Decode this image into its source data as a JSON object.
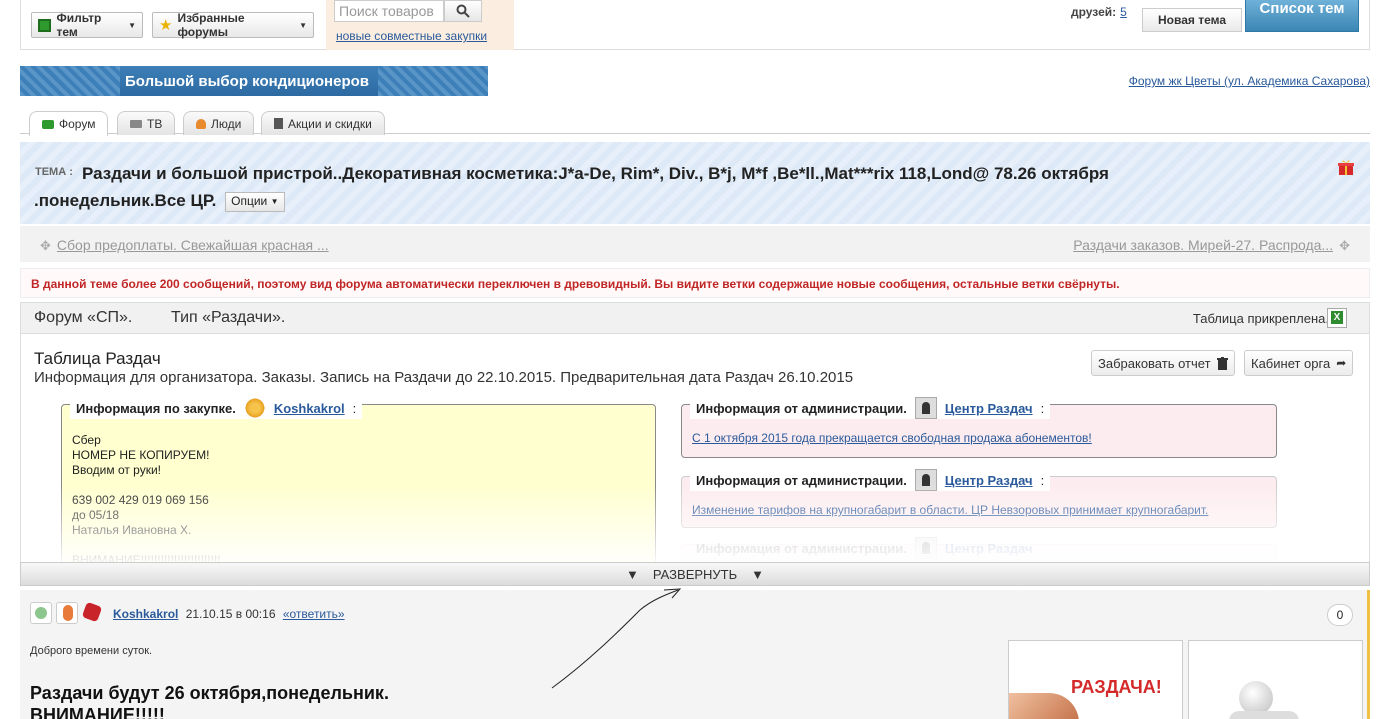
{
  "header": {
    "filter_label": "Фильтр тем",
    "favorites_label": "Избранные форумы",
    "search_placeholder": "Поиск товаров",
    "joint_purchases_link": "новые совместные закупки",
    "friends_label": "друзей:",
    "friends_count": "5",
    "new_topic_label": "Новая тема",
    "topic_list_label": "Список тем"
  },
  "banner": {
    "text": "Большой выбор кондиционеров",
    "forum_link": "Форум жк Цветы (ул. Академика Сахарова)"
  },
  "tabs": [
    {
      "label": "Форум",
      "icon": "chat-icon"
    },
    {
      "label": "ТВ",
      "icon": "tv-icon"
    },
    {
      "label": "Люди",
      "icon": "people-icon"
    },
    {
      "label": "Акции и скидки",
      "icon": "document-icon"
    }
  ],
  "topic": {
    "label": "ТЕМА :",
    "title": "Раздачи и большой пристрой..Декоративная косметика:J*a-De, Rim*, Div., B*j, M*f ,Be*ll.,Mat***rix 118,Lond@ 78.26 октября .понедельник.Все ЦР.",
    "options_label": "Опции"
  },
  "nav": {
    "prev": "Сбор предоплаты. Свежайшая красная ...",
    "next": "Раздачи заказов. Мирей-27. Распрода..."
  },
  "warning": "В данной теме более 200 сообщений, поэтому вид форума автоматически переключен в древовидный. Вы видите ветки содержащие новые сообщения, остальные ветки свёрнуты.",
  "forum_type": {
    "forum": "Форум «СП».",
    "type": "Тип «Раздачи».",
    "attached": "Таблица прикреплена."
  },
  "table_card": {
    "title": "Таблица Раздач",
    "subtitle": "Информация для организатора. Заказы. Запись на Раздачи до 22.10.2015. Предварительная дата Раздач 26.10.2015",
    "reject_btn": "Забраковать отчет",
    "cabinet_btn": "Кабинет орга",
    "purchase_info": {
      "legend": "Информация по закупке.",
      "user": "Koshkakrol",
      "colon": ":",
      "lines": [
        "Сбер",
        "НОМЕР НЕ КОПИРУЕМ!",
        "Вводим от руки!",
        "",
        "639 002 429 019 069 156",
        "до 05/18",
        "Наталья Ивановна Х.",
        "",
        "ВНИМАНИЕ!!!!!!!!!!!!!!!!!!!!!!!!"
      ]
    },
    "admin_info_1": {
      "legend": "Информация от администрации.",
      "user": "Центр Раздач",
      "colon": ":",
      "link": "С 1 октября 2015 года прекращается свободная продажа абонементов!"
    },
    "admin_info_2": {
      "legend": "Информация от администрации.",
      "user": "Центр Раздач",
      "colon": ":",
      "link": "Изменение тарифов на крупногабарит в области. ЦР Невзоровых принимает крупногабарит."
    },
    "admin_info_3": {
      "legend": "Информация от администрации.",
      "user": "Центр Раздач"
    }
  },
  "expand": {
    "arrow": "▼",
    "label": "РАЗВЕРНУТЬ"
  },
  "post": {
    "user": "Koshkakrol",
    "date": "21.10.15 в 00:16",
    "reply": "«ответить»",
    "count": "0",
    "greeting": "Доброго времени суток.",
    "headline1": "Раздачи будут 26 октября,понедельник.",
    "headline2": "ВНИМАНИЕ!!!!!",
    "thumb_text": "РАЗДАЧА!"
  }
}
